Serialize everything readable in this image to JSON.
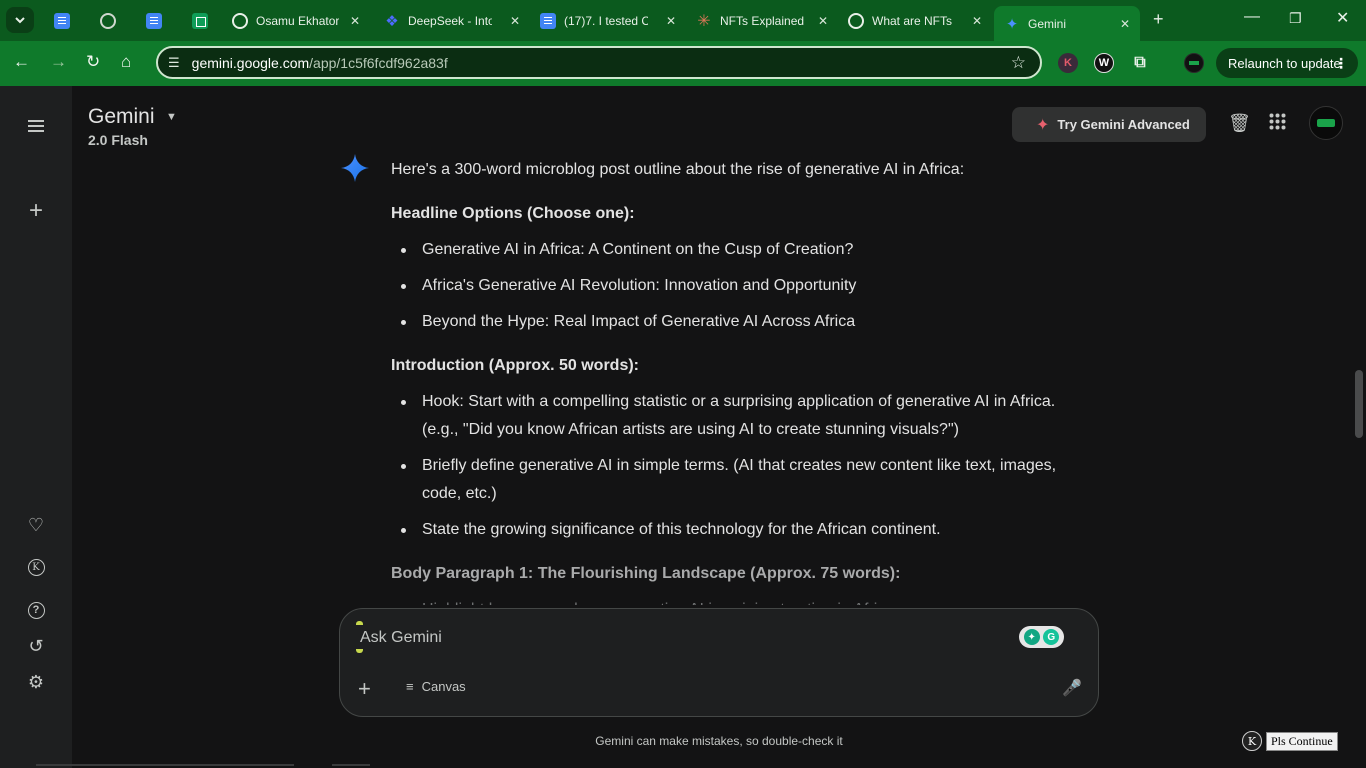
{
  "browser": {
    "tabs": [
      {
        "title": "",
        "icon": "docs-icon"
      },
      {
        "title": "",
        "icon": "globe-icon"
      },
      {
        "title": "",
        "icon": "docs-icon"
      },
      {
        "title": "",
        "icon": "sheets-icon"
      },
      {
        "title": "Osamu Ekhator",
        "icon": "openai-icon"
      },
      {
        "title": "DeepSeek - Into",
        "icon": "deepseek-icon"
      },
      {
        "title": "(17)7. I tested C",
        "icon": "docs-icon"
      },
      {
        "title": "NFTs Explained",
        "icon": "claude-icon"
      },
      {
        "title": "What are NFTs",
        "icon": "openai-icon"
      },
      {
        "title": "Gemini",
        "icon": "gemini-icon",
        "active": true
      }
    ],
    "url_host": "gemini.google.com",
    "url_path": "/app/1c5f6fcdf962a83f",
    "relaunch_label": "Relaunch to update",
    "accent_color": "#0f7a2b"
  },
  "header": {
    "app_title": "Gemini",
    "model": "2.0 Flash",
    "try_advanced": "Try Gemini Advanced"
  },
  "response": {
    "intro": "Here's a 300-word microblog post outline about the rise of generative AI in Africa:",
    "sections": [
      {
        "heading": "Headline Options (Choose one):",
        "items": [
          "Generative AI in Africa: A Continent on the Cusp of Creation?",
          "Africa's Generative AI Revolution: Innovation and Opportunity",
          "Beyond the Hype: Real Impact of Generative AI Across Africa"
        ]
      },
      {
        "heading": "Introduction (Approx. 50 words):",
        "items": [
          "Hook: Start with a compelling statistic or a surprising application of generative AI in Africa. (e.g., \"Did you know African artists are using AI to create stunning visuals?\")",
          "Briefly define generative AI in simple terms. (AI that creates new content like text, images, code, etc.)",
          "State the growing significance of this technology for the African continent."
        ]
      },
      {
        "heading": "Body Paragraph 1: The Flourishing Landscape (Approx. 75 words):",
        "items": [
          "Highlight key areas where generative AI is gaining traction in Africa."
        ]
      }
    ]
  },
  "input": {
    "placeholder": "Ask Gemini",
    "canvas_label": "Canvas"
  },
  "footer": {
    "disclaimer": "Gemini can make mistakes, so double-check it",
    "continue_label": "Pls Continue",
    "continue_k": "K"
  }
}
